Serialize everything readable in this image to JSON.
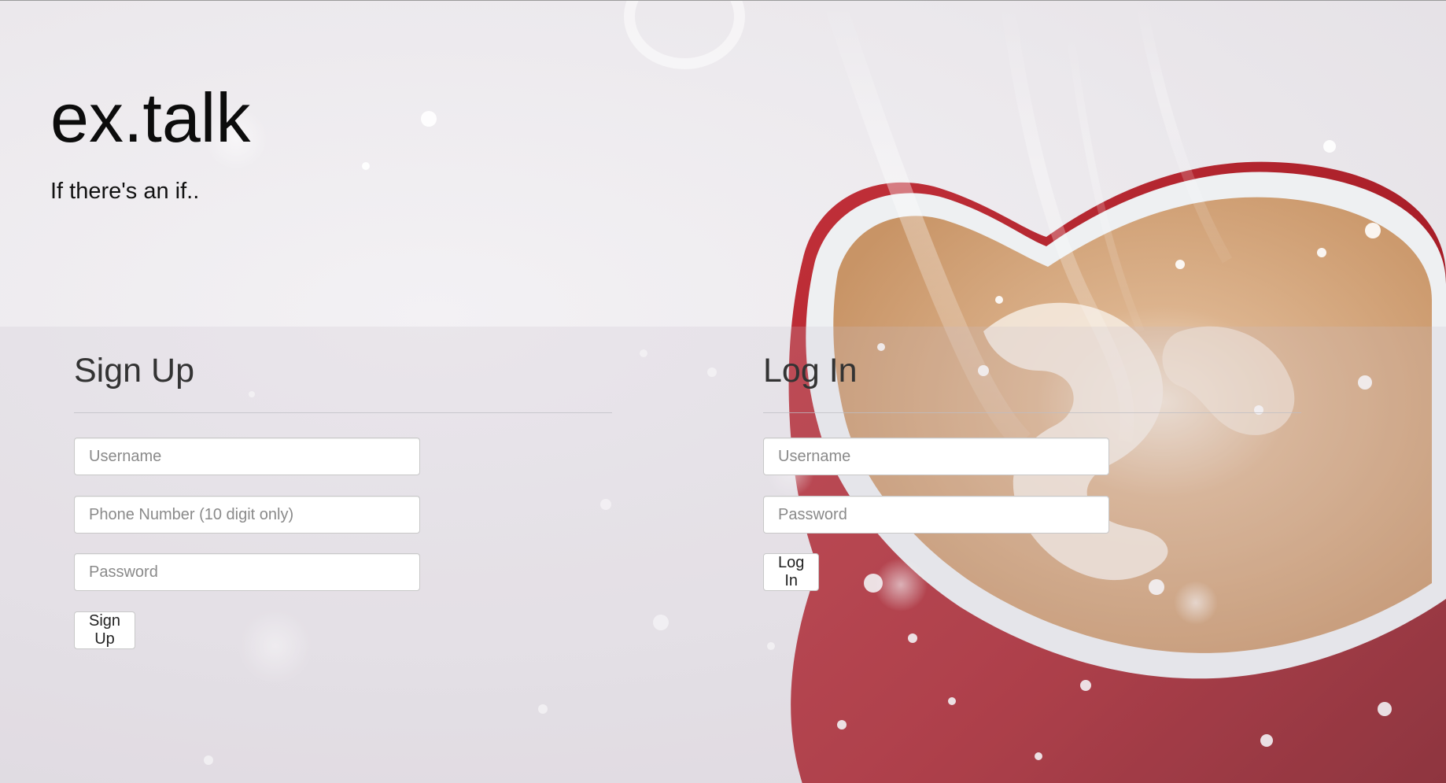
{
  "header": {
    "title": "ex.talk",
    "tagline": "If there's an if.."
  },
  "signup": {
    "heading": "Sign Up",
    "username_placeholder": "Username",
    "phone_placeholder": "Phone Number (10 digit only)",
    "password_placeholder": "Password",
    "submit_label": "Sign Up"
  },
  "login": {
    "heading": "Log In",
    "username_placeholder": "Username",
    "password_placeholder": "Password",
    "submit_label": "Log In"
  },
  "colors": {
    "mug_red": "#b8262e",
    "coffee_foam": "#d9b08c",
    "background": "#ece9ed"
  }
}
